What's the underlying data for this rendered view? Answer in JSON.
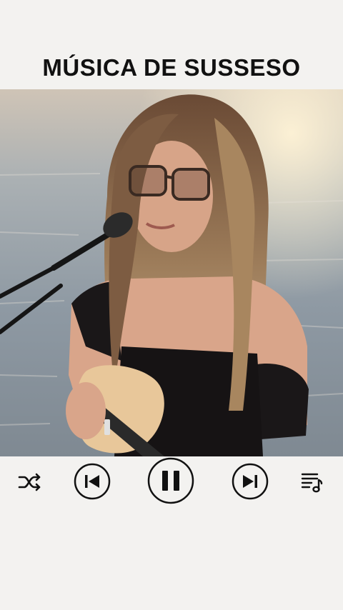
{
  "header": {
    "title": "MÚSICA DE SUSSESO"
  },
  "player": {
    "controls": {
      "shuffle": "shuffle-icon",
      "previous": "skip-previous-icon",
      "play_pause": "pause-icon",
      "next": "skip-next-icon",
      "queue": "playlist-icon"
    },
    "state": "playing"
  },
  "colors": {
    "background": "#f3f2f0",
    "icon": "#111111",
    "title": "#111111"
  }
}
